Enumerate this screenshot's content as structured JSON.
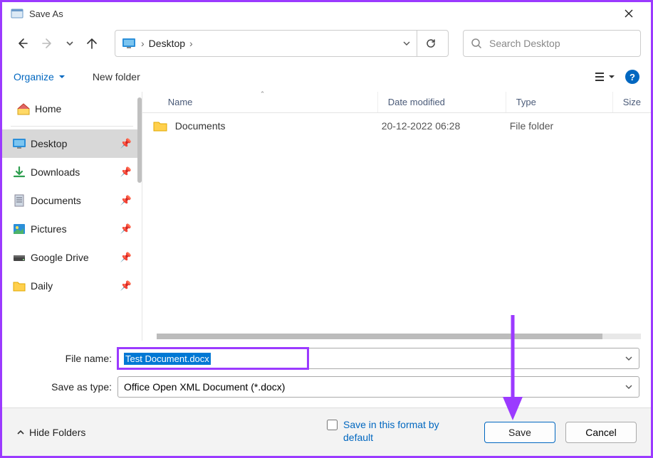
{
  "window": {
    "title": "Save As"
  },
  "breadcrumb": {
    "location": "Desktop"
  },
  "search": {
    "placeholder": "Search Desktop"
  },
  "toolbar": {
    "organize": "Organize",
    "new_folder": "New folder"
  },
  "sidebar": {
    "home": "Home",
    "items": [
      {
        "label": "Desktop"
      },
      {
        "label": "Downloads"
      },
      {
        "label": "Documents"
      },
      {
        "label": "Pictures"
      },
      {
        "label": "Google Drive"
      },
      {
        "label": "Daily"
      }
    ]
  },
  "columns": {
    "name": "Name",
    "date": "Date modified",
    "type": "Type",
    "size": "Size"
  },
  "files": [
    {
      "name": "Documents",
      "date": "20-12-2022 06:28",
      "type": "File folder"
    }
  ],
  "form": {
    "filename_label": "File name:",
    "filename_value": "Test Document.docx",
    "type_label": "Save as type:",
    "type_value": "Office Open XML Document (*.docx)"
  },
  "footer": {
    "hide_folders": "Hide Folders",
    "format_checkbox": "Save in this format by default",
    "save": "Save",
    "cancel": "Cancel"
  }
}
